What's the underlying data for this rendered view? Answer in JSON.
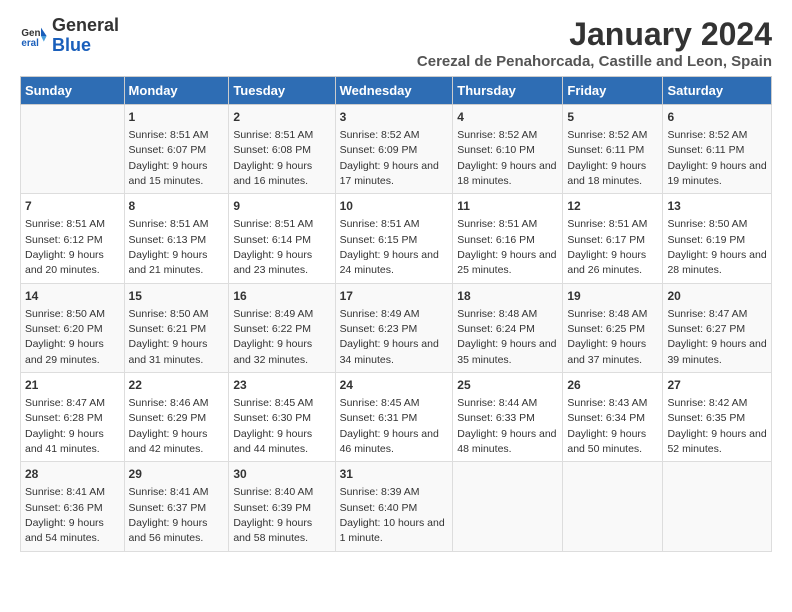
{
  "header": {
    "logo_general": "General",
    "logo_blue": "Blue",
    "title": "January 2024",
    "subtitle": "Cerezal de Penahorcada, Castille and Leon, Spain"
  },
  "days_of_week": [
    "Sunday",
    "Monday",
    "Tuesday",
    "Wednesday",
    "Thursday",
    "Friday",
    "Saturday"
  ],
  "weeks": [
    [
      {
        "day": "",
        "sunrise": "",
        "sunset": "",
        "daylight": ""
      },
      {
        "day": "1",
        "sunrise": "Sunrise: 8:51 AM",
        "sunset": "Sunset: 6:07 PM",
        "daylight": "Daylight: 9 hours and 15 minutes."
      },
      {
        "day": "2",
        "sunrise": "Sunrise: 8:51 AM",
        "sunset": "Sunset: 6:08 PM",
        "daylight": "Daylight: 9 hours and 16 minutes."
      },
      {
        "day": "3",
        "sunrise": "Sunrise: 8:52 AM",
        "sunset": "Sunset: 6:09 PM",
        "daylight": "Daylight: 9 hours and 17 minutes."
      },
      {
        "day": "4",
        "sunrise": "Sunrise: 8:52 AM",
        "sunset": "Sunset: 6:10 PM",
        "daylight": "Daylight: 9 hours and 18 minutes."
      },
      {
        "day": "5",
        "sunrise": "Sunrise: 8:52 AM",
        "sunset": "Sunset: 6:11 PM",
        "daylight": "Daylight: 9 hours and 18 minutes."
      },
      {
        "day": "6",
        "sunrise": "Sunrise: 8:52 AM",
        "sunset": "Sunset: 6:11 PM",
        "daylight": "Daylight: 9 hours and 19 minutes."
      }
    ],
    [
      {
        "day": "7",
        "sunrise": "Sunrise: 8:51 AM",
        "sunset": "Sunset: 6:12 PM",
        "daylight": "Daylight: 9 hours and 20 minutes."
      },
      {
        "day": "8",
        "sunrise": "Sunrise: 8:51 AM",
        "sunset": "Sunset: 6:13 PM",
        "daylight": "Daylight: 9 hours and 21 minutes."
      },
      {
        "day": "9",
        "sunrise": "Sunrise: 8:51 AM",
        "sunset": "Sunset: 6:14 PM",
        "daylight": "Daylight: 9 hours and 23 minutes."
      },
      {
        "day": "10",
        "sunrise": "Sunrise: 8:51 AM",
        "sunset": "Sunset: 6:15 PM",
        "daylight": "Daylight: 9 hours and 24 minutes."
      },
      {
        "day": "11",
        "sunrise": "Sunrise: 8:51 AM",
        "sunset": "Sunset: 6:16 PM",
        "daylight": "Daylight: 9 hours and 25 minutes."
      },
      {
        "day": "12",
        "sunrise": "Sunrise: 8:51 AM",
        "sunset": "Sunset: 6:17 PM",
        "daylight": "Daylight: 9 hours and 26 minutes."
      },
      {
        "day": "13",
        "sunrise": "Sunrise: 8:50 AM",
        "sunset": "Sunset: 6:19 PM",
        "daylight": "Daylight: 9 hours and 28 minutes."
      }
    ],
    [
      {
        "day": "14",
        "sunrise": "Sunrise: 8:50 AM",
        "sunset": "Sunset: 6:20 PM",
        "daylight": "Daylight: 9 hours and 29 minutes."
      },
      {
        "day": "15",
        "sunrise": "Sunrise: 8:50 AM",
        "sunset": "Sunset: 6:21 PM",
        "daylight": "Daylight: 9 hours and 31 minutes."
      },
      {
        "day": "16",
        "sunrise": "Sunrise: 8:49 AM",
        "sunset": "Sunset: 6:22 PM",
        "daylight": "Daylight: 9 hours and 32 minutes."
      },
      {
        "day": "17",
        "sunrise": "Sunrise: 8:49 AM",
        "sunset": "Sunset: 6:23 PM",
        "daylight": "Daylight: 9 hours and 34 minutes."
      },
      {
        "day": "18",
        "sunrise": "Sunrise: 8:48 AM",
        "sunset": "Sunset: 6:24 PM",
        "daylight": "Daylight: 9 hours and 35 minutes."
      },
      {
        "day": "19",
        "sunrise": "Sunrise: 8:48 AM",
        "sunset": "Sunset: 6:25 PM",
        "daylight": "Daylight: 9 hours and 37 minutes."
      },
      {
        "day": "20",
        "sunrise": "Sunrise: 8:47 AM",
        "sunset": "Sunset: 6:27 PM",
        "daylight": "Daylight: 9 hours and 39 minutes."
      }
    ],
    [
      {
        "day": "21",
        "sunrise": "Sunrise: 8:47 AM",
        "sunset": "Sunset: 6:28 PM",
        "daylight": "Daylight: 9 hours and 41 minutes."
      },
      {
        "day": "22",
        "sunrise": "Sunrise: 8:46 AM",
        "sunset": "Sunset: 6:29 PM",
        "daylight": "Daylight: 9 hours and 42 minutes."
      },
      {
        "day": "23",
        "sunrise": "Sunrise: 8:45 AM",
        "sunset": "Sunset: 6:30 PM",
        "daylight": "Daylight: 9 hours and 44 minutes."
      },
      {
        "day": "24",
        "sunrise": "Sunrise: 8:45 AM",
        "sunset": "Sunset: 6:31 PM",
        "daylight": "Daylight: 9 hours and 46 minutes."
      },
      {
        "day": "25",
        "sunrise": "Sunrise: 8:44 AM",
        "sunset": "Sunset: 6:33 PM",
        "daylight": "Daylight: 9 hours and 48 minutes."
      },
      {
        "day": "26",
        "sunrise": "Sunrise: 8:43 AM",
        "sunset": "Sunset: 6:34 PM",
        "daylight": "Daylight: 9 hours and 50 minutes."
      },
      {
        "day": "27",
        "sunrise": "Sunrise: 8:42 AM",
        "sunset": "Sunset: 6:35 PM",
        "daylight": "Daylight: 9 hours and 52 minutes."
      }
    ],
    [
      {
        "day": "28",
        "sunrise": "Sunrise: 8:41 AM",
        "sunset": "Sunset: 6:36 PM",
        "daylight": "Daylight: 9 hours and 54 minutes."
      },
      {
        "day": "29",
        "sunrise": "Sunrise: 8:41 AM",
        "sunset": "Sunset: 6:37 PM",
        "daylight": "Daylight: 9 hours and 56 minutes."
      },
      {
        "day": "30",
        "sunrise": "Sunrise: 8:40 AM",
        "sunset": "Sunset: 6:39 PM",
        "daylight": "Daylight: 9 hours and 58 minutes."
      },
      {
        "day": "31",
        "sunrise": "Sunrise: 8:39 AM",
        "sunset": "Sunset: 6:40 PM",
        "daylight": "Daylight: 10 hours and 1 minute."
      },
      {
        "day": "",
        "sunrise": "",
        "sunset": "",
        "daylight": ""
      },
      {
        "day": "",
        "sunrise": "",
        "sunset": "",
        "daylight": ""
      },
      {
        "day": "",
        "sunrise": "",
        "sunset": "",
        "daylight": ""
      }
    ]
  ]
}
